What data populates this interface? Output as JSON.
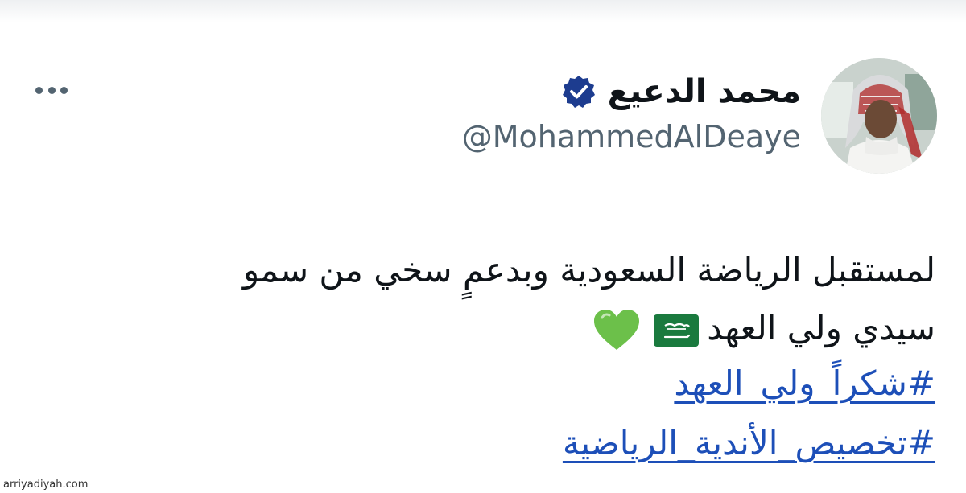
{
  "author": {
    "display_name": "محمد الدعيع",
    "handle": "@MohammedAlDeaye",
    "avatar_icon": "profile-photo",
    "verified_icon": "verified-badge-icon"
  },
  "actions": {
    "more_icon": "more-horizontal-icon"
  },
  "tweet": {
    "line_1": "لمستقبل الرياضة السعودية وبدعمٍ سخي من سمو",
    "line_2": "سيدي ولي العهد",
    "emoji": [
      "saudi-flag-emoji",
      "green-heart-emoji"
    ],
    "hashtags": [
      "#شكراً_ولي_العهد",
      "#تخصيص_الأندية_الرياضية"
    ]
  },
  "watermark": "arriyadiyah.com",
  "colors": {
    "text": "#0f1419",
    "secondary_text": "#536471",
    "hashtag": "#1d4fb8",
    "verified": "#1d3c8f",
    "background": "#ffffff"
  }
}
